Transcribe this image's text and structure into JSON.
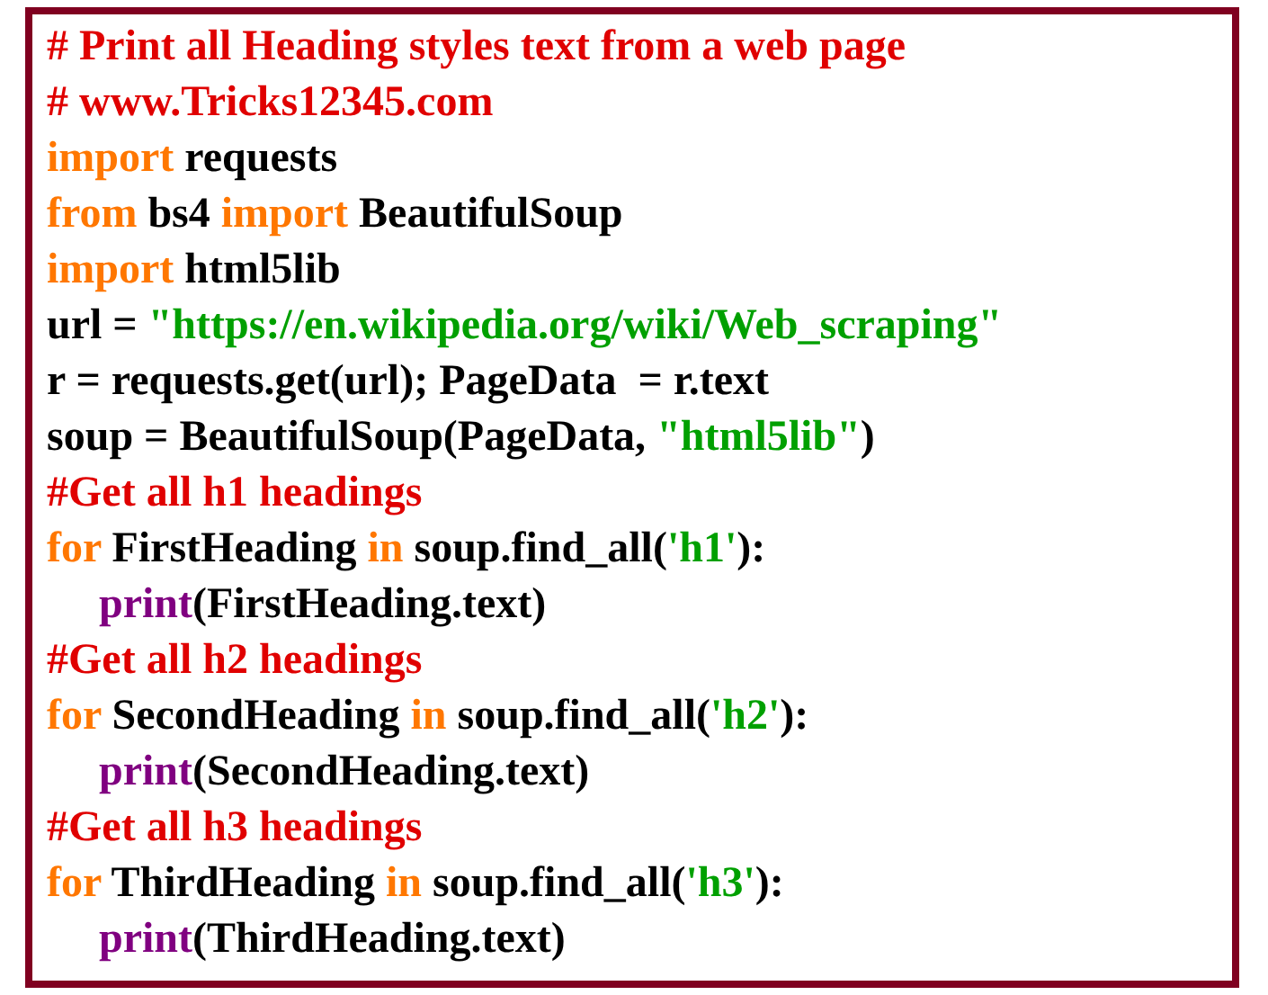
{
  "code_lines": [
    {
      "indented": false,
      "tokens": [
        {
          "kind": "comment",
          "text": "# Print all Heading styles text from a web page"
        }
      ]
    },
    {
      "indented": false,
      "tokens": [
        {
          "kind": "comment",
          "text": "# www.Tricks12345.com"
        }
      ]
    },
    {
      "indented": false,
      "tokens": [
        {
          "kind": "keyword",
          "text": "import"
        },
        {
          "kind": "plain",
          "text": " requests"
        }
      ]
    },
    {
      "indented": false,
      "tokens": [
        {
          "kind": "keyword",
          "text": "from"
        },
        {
          "kind": "plain",
          "text": " bs4 "
        },
        {
          "kind": "keyword",
          "text": "import"
        },
        {
          "kind": "plain",
          "text": " BeautifulSoup"
        }
      ]
    },
    {
      "indented": false,
      "tokens": [
        {
          "kind": "keyword",
          "text": "import"
        },
        {
          "kind": "plain",
          "text": " html5lib"
        }
      ]
    },
    {
      "indented": false,
      "tokens": [
        {
          "kind": "plain",
          "text": "url = "
        },
        {
          "kind": "string",
          "text": "\"https://en.wikipedia.org/wiki/Web_scraping\""
        }
      ]
    },
    {
      "indented": false,
      "tokens": [
        {
          "kind": "plain",
          "text": "r = requests.get(url); PageData  = r.text"
        }
      ]
    },
    {
      "indented": false,
      "tokens": [
        {
          "kind": "plain",
          "text": "soup = BeautifulSoup(PageData, "
        },
        {
          "kind": "string",
          "text": "\"html5lib\""
        },
        {
          "kind": "plain",
          "text": ")"
        }
      ]
    },
    {
      "indented": false,
      "tokens": [
        {
          "kind": "comment",
          "text": "#Get all h1 headings"
        }
      ]
    },
    {
      "indented": false,
      "tokens": [
        {
          "kind": "keyword",
          "text": "for"
        },
        {
          "kind": "plain",
          "text": " FirstHeading "
        },
        {
          "kind": "keyword",
          "text": "in"
        },
        {
          "kind": "plain",
          "text": " soup.find_all("
        },
        {
          "kind": "string",
          "text": "'h1'"
        },
        {
          "kind": "plain",
          "text": "):"
        }
      ]
    },
    {
      "indented": true,
      "tokens": [
        {
          "kind": "builtin",
          "text": "print"
        },
        {
          "kind": "plain",
          "text": "(FirstHeading.text)"
        }
      ]
    },
    {
      "indented": false,
      "tokens": [
        {
          "kind": "comment",
          "text": "#Get all h2 headings"
        }
      ]
    },
    {
      "indented": false,
      "tokens": [
        {
          "kind": "keyword",
          "text": "for"
        },
        {
          "kind": "plain",
          "text": " SecondHeading "
        },
        {
          "kind": "keyword",
          "text": "in"
        },
        {
          "kind": "plain",
          "text": " soup.find_all("
        },
        {
          "kind": "string",
          "text": "'h2'"
        },
        {
          "kind": "plain",
          "text": "):"
        }
      ]
    },
    {
      "indented": true,
      "tokens": [
        {
          "kind": "builtin",
          "text": "print"
        },
        {
          "kind": "plain",
          "text": "(SecondHeading.text)"
        }
      ]
    },
    {
      "indented": false,
      "tokens": [
        {
          "kind": "comment",
          "text": "#Get all h3 headings"
        }
      ]
    },
    {
      "indented": false,
      "tokens": [
        {
          "kind": "keyword",
          "text": "for"
        },
        {
          "kind": "plain",
          "text": " ThirdHeading "
        },
        {
          "kind": "keyword",
          "text": "in"
        },
        {
          "kind": "plain",
          "text": " soup.find_all("
        },
        {
          "kind": "string",
          "text": "'h3'"
        },
        {
          "kind": "plain",
          "text": "):"
        }
      ]
    },
    {
      "indented": true,
      "tokens": [
        {
          "kind": "builtin",
          "text": "print"
        },
        {
          "kind": "plain",
          "text": "(ThirdHeading.text)"
        }
      ]
    }
  ]
}
